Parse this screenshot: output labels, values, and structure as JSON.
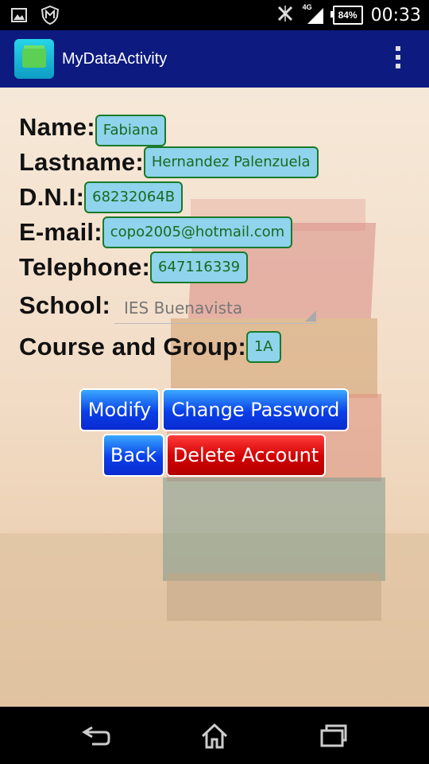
{
  "status_bar": {
    "network": "4G",
    "battery": "84%",
    "time": "00:33"
  },
  "action_bar": {
    "title": "MyDataActivity"
  },
  "profile": {
    "name_label": "Name:",
    "name_value": "Fabiana",
    "lastname_label": "Lastname:",
    "lastname_value": "Hernandez Palenzuela",
    "dni_label": "D.N.I:",
    "dni_value": "68232064B",
    "email_label": "E-mail:",
    "email_value": "copo2005@hotmail.com",
    "telephone_label": "Telephone:",
    "telephone_value": "647116339",
    "school_label": "School:",
    "school_value": "IES Buenavista",
    "course_label": "Course and Group:",
    "course_value": "1A"
  },
  "buttons": {
    "modify": "Modify",
    "change_password": "Change Password",
    "back": "Back",
    "delete_account": "Delete Account"
  },
  "colors": {
    "action_bar": "#0d1a80",
    "field_bg": "#8fd3ec",
    "field_border": "#1a7a2a",
    "button_blue": "#0a3fe8",
    "button_red": "#d10000"
  },
  "icons": [
    "image-icon",
    "mcafee-icon",
    "no-signal-icon",
    "signal-icon",
    "battery-icon",
    "overflow-menu-icon",
    "back-icon",
    "home-icon",
    "recents-icon"
  ]
}
